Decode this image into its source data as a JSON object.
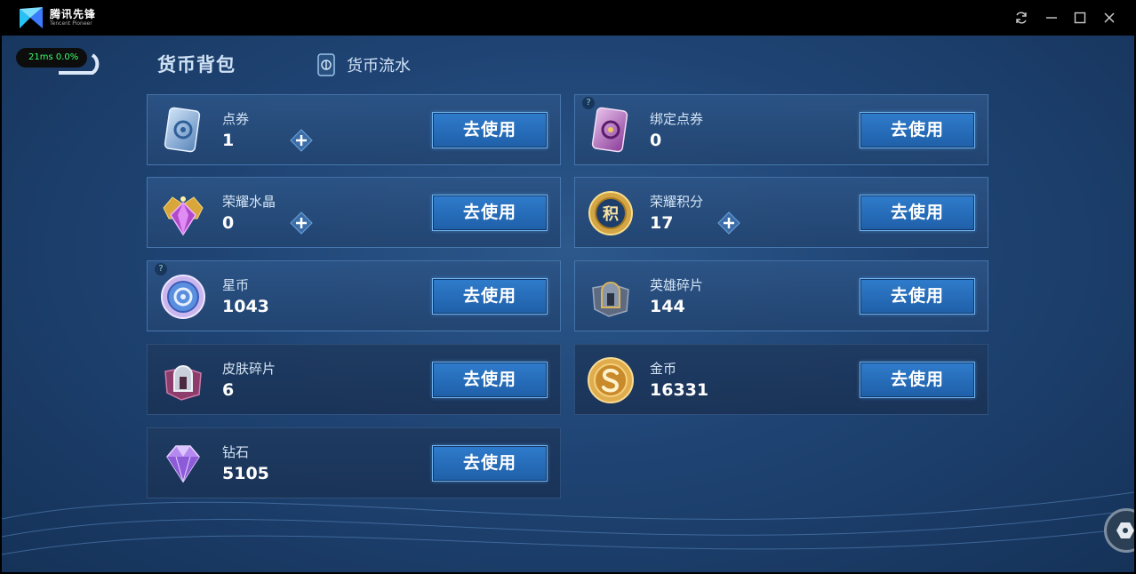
{
  "window": {
    "app_name_cn": "腾讯先锋",
    "app_name_en": "Tencent Pioneer",
    "controls": [
      "refresh-icon",
      "minimize-icon",
      "maximize-icon",
      "close-icon"
    ]
  },
  "overlay": {
    "net_stats": "21ms  0.0%"
  },
  "tabs": {
    "active": "货币背包",
    "history": "货币流水"
  },
  "currencies": [
    {
      "name": "点券",
      "value": "1",
      "icon": "coupon-card-icon",
      "has_plus": true,
      "has_question": false,
      "button": "去使用"
    },
    {
      "name": "绑定点券",
      "value": "0",
      "icon": "bound-coupon-card-icon",
      "has_plus": false,
      "has_question": true,
      "button": "去使用"
    },
    {
      "name": "荣耀水晶",
      "value": "0",
      "icon": "glory-crystal-icon",
      "has_plus": true,
      "has_question": false,
      "button": "去使用"
    },
    {
      "name": "荣耀积分",
      "value": "17",
      "icon": "glory-points-icon",
      "has_plus": true,
      "has_question": false,
      "button": "去使用"
    },
    {
      "name": "星币",
      "value": "1043",
      "icon": "star-coin-icon",
      "has_plus": false,
      "has_question": true,
      "button": "去使用"
    },
    {
      "name": "英雄碎片",
      "value": "144",
      "icon": "hero-fragment-icon",
      "has_plus": false,
      "has_question": false,
      "button": "去使用"
    },
    {
      "name": "皮肤碎片",
      "value": "6",
      "icon": "skin-fragment-icon",
      "has_plus": false,
      "has_question": false,
      "button": "去使用"
    },
    {
      "name": "金币",
      "value": "16331",
      "icon": "gold-coin-icon",
      "has_plus": false,
      "has_question": false,
      "button": "去使用"
    },
    {
      "name": "钻石",
      "value": "5105",
      "icon": "diamond-icon",
      "has_plus": false,
      "has_question": false,
      "button": "去使用"
    }
  ],
  "icon_logo_badge": "积",
  "question_mark": "?",
  "colors": {
    "background": "#1f4474",
    "button": "#2a70be",
    "button_border": "#6fb2f0",
    "net_stats": "#39ff6a"
  }
}
